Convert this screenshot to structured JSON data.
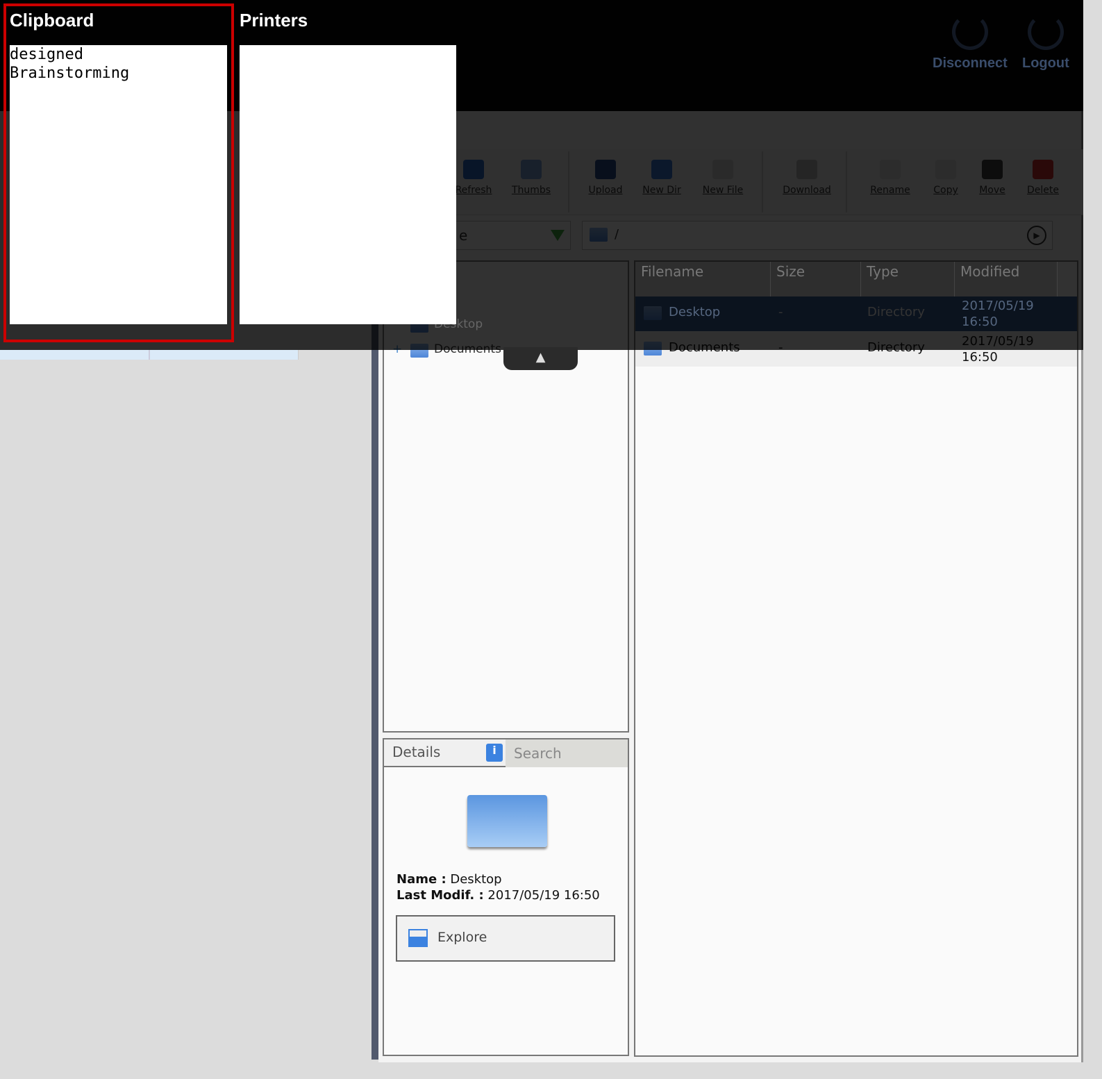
{
  "header": {
    "disconnect": "Disconnect",
    "logout": "Logout"
  },
  "toolbar": [
    {
      "label": "Refresh",
      "icon": "refresh-icon",
      "color": "#2a6cc8"
    },
    {
      "label": "Thumbs",
      "icon": "thumbs-icon",
      "color": "#7aa0d8"
    },
    {
      "label": "Upload",
      "icon": "upload-icon",
      "color": "#2a4a8a"
    },
    {
      "label": "New Dir",
      "icon": "new-dir-icon",
      "color": "#3a7ad8"
    },
    {
      "label": "New File",
      "icon": "new-file-icon",
      "color": "#cfcfcf"
    },
    {
      "label": "Download",
      "icon": "download-icon",
      "color": "#bbbbbb"
    },
    {
      "label": "Rename",
      "icon": "rename-icon",
      "color": "#dddddd"
    },
    {
      "label": "Copy",
      "icon": "copy-icon",
      "color": "#dddddd"
    },
    {
      "label": "Move",
      "icon": "move-icon",
      "color": "#444444"
    },
    {
      "label": "Delete",
      "icon": "delete-icon",
      "color": "#d03030"
    }
  ],
  "drive": {
    "value": "e"
  },
  "path": {
    "value": "/"
  },
  "tree": {
    "items": [
      "Desktop",
      "Documents"
    ]
  },
  "list": {
    "columns": [
      "Filename",
      "Size",
      "Type",
      "Modified"
    ],
    "rows": [
      {
        "name": "Desktop",
        "size": "-",
        "type": "Directory",
        "modified": "2017/05/19 16:50",
        "selected": true
      },
      {
        "name": "Documents",
        "size": "-",
        "type": "Directory",
        "modified": "2017/05/19 16:50",
        "selected": false
      }
    ]
  },
  "details": {
    "tab_details": "Details",
    "tab_search": "Search",
    "name_label": "Name :",
    "name_value": "Desktop",
    "modif_label": "Last Modif. :",
    "modif_value": "2017/05/19 16:50",
    "explore": "Explore"
  },
  "panels": {
    "clipboard_title": "Clipboard",
    "clipboard_text": "designed\nBrainstorming",
    "printers_title": "Printers",
    "collapse": "▲"
  },
  "colors": {
    "highlight": "#cc0000",
    "selected_row": "#3a5f95"
  }
}
